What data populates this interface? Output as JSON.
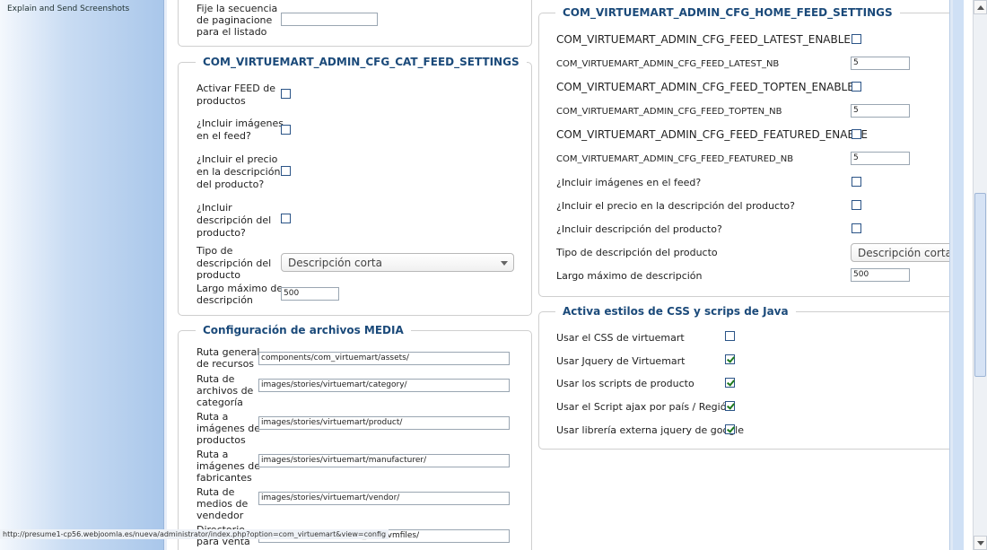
{
  "sidebar": {
    "link": "Explain and Send Screenshots"
  },
  "left_top": {
    "label_l1": "Fije la secuencia",
    "label_l2": "de paginacione",
    "label_l3": "para el listado",
    "value": ""
  },
  "cat_feed": {
    "legend": "COM_VIRTUEMART_ADMIN_CFG_CAT_FEED_SETTINGS",
    "activar_l1": "Activar FEED de",
    "activar_l2": "productos",
    "imagenes_l1": "¿Incluir imágenes",
    "imagenes_l2": "en el feed?",
    "precio_l1": "¿Incluir el precio",
    "precio_l2": "en la descripción",
    "precio_l3": "del producto?",
    "desc_l1": "¿Incluir",
    "desc_l2": "descripción del",
    "desc_l3": "producto?",
    "tipo_l1": "Tipo de",
    "tipo_l2": "descripción del",
    "tipo_l3": "producto",
    "tipo_value": "Descripción corta",
    "largo_l1": "Largo máximo de",
    "largo_l2": "descripción",
    "largo_value": "500"
  },
  "media": {
    "legend": "Configuración de archivos MEDIA",
    "rows": [
      {
        "l1": "Ruta general",
        "l2": "de recursos",
        "l3": "",
        "value": "components/com_virtuemart/assets/"
      },
      {
        "l1": "Ruta de",
        "l2": "archivos de",
        "l3": "categoría",
        "value": "images/stories/virtuemart/category/"
      },
      {
        "l1": "Ruta a",
        "l2": "imágenes de",
        "l3": "productos",
        "value": "images/stories/virtuemart/product/"
      },
      {
        "l1": "Ruta a",
        "l2": "imágenes de",
        "l3": "fabricantes",
        "value": "images/stories/virtuemart/manufacturer/"
      },
      {
        "l1": "Ruta de",
        "l2": "medios de",
        "l3": "vendedor",
        "value": "images/stories/virtuemart/vendor/"
      },
      {
        "l1": "Directorio",
        "l2": "para venta",
        "l3": "",
        "value": "/home2/presume1/public_html/vmfiles/"
      }
    ]
  },
  "home_feed": {
    "legend": "COM_VIRTUEMART_ADMIN_CFG_HOME_FEED_SETTINGS",
    "latest_enable": "COM_VIRTUEMART_ADMIN_CFG_FEED_LATEST_ENABLE",
    "latest_nb": "COM_VIRTUEMART_ADMIN_CFG_FEED_LATEST_NB",
    "latest_nb_value": "5",
    "topten_enable": "COM_VIRTUEMART_ADMIN_CFG_FEED_TOPTEN_ENABLE",
    "topten_nb": "COM_VIRTUEMART_ADMIN_CFG_FEED_TOPTEN_NB",
    "topten_nb_value": "5",
    "featured_enable": "COM_VIRTUEMART_ADMIN_CFG_FEED_FEATURED_ENABLE",
    "featured_nb": "COM_VIRTUEMART_ADMIN_CFG_FEED_FEATURED_NB",
    "featured_nb_value": "5",
    "imagenes": "¿Incluir imágenes en el feed?",
    "precio": "¿Incluir el precio en la descripción del producto?",
    "desc": "¿Incluir descripción del producto?",
    "tipo": "Tipo de descripción del producto",
    "tipo_value": "Descripción corta",
    "largo": "Largo máximo de descripción",
    "largo_value": "500"
  },
  "css_js": {
    "legend": "Activa estilos de CSS y scrips de Java",
    "css": "Usar el CSS de virtuemart",
    "css_checked": false,
    "jquery": "Usar Jquery de Virtuemart",
    "jquery_checked": true,
    "scripts": "Usar los scripts de producto",
    "scripts_checked": true,
    "ajax": "Usar el Script ajax por país / Región",
    "ajax_checked": true,
    "google": "Usar librería externa jquery de google",
    "google_checked": true
  },
  "status": {
    "url": "http://presume1-cp56.webjoomla.es/nueva/administrator/index.php?option=com_virtuemart&view=config"
  }
}
